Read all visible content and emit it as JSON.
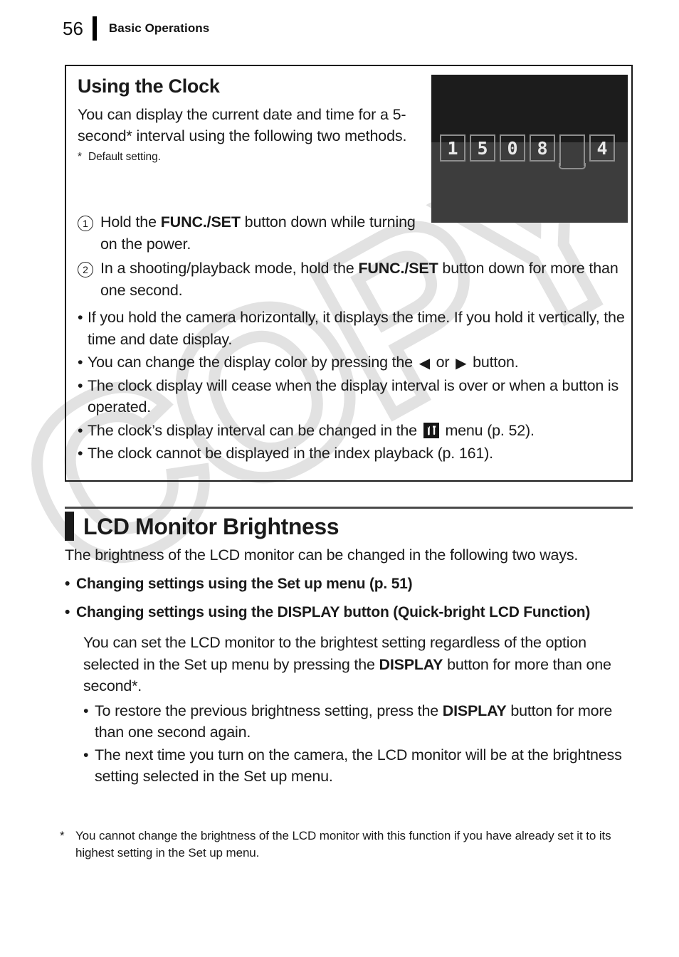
{
  "header": {
    "page_number": "56",
    "title": "Basic Operations"
  },
  "tip_box": {
    "title": "Using the Clock",
    "lead": "You can display the current date and time for a 5-second* interval using the following two methods.",
    "footnote_star": "*",
    "footnote": "Default setting.",
    "lcd_screenshot": {
      "label": "camera-lcd-clock-display",
      "digits": [
        "1",
        "5",
        "0",
        "8",
        "",
        "4"
      ],
      "blank_index": 4,
      "bg_top_color": "#1c1c1c",
      "bg_bottom_color": "#3d3d3d",
      "digit_color": "#e8e8e8",
      "cell_border_color": "#8e8e8e"
    },
    "steps": [
      {
        "num": "1",
        "pre": "Hold the ",
        "bold": "FUNC./SET",
        "post": " button down while turning on the power."
      },
      {
        "num": "2",
        "pre": "In a shooting/playback mode, hold the ",
        "bold": "FUNC./SET",
        "post": " button down for more than one second."
      }
    ],
    "bullets": [
      {
        "text": "If you hold the camera horizontally, it displays the time. If you hold it vertically, the time and date display."
      },
      {
        "pre": "You can change the display color by pressing the ",
        "icon_left": "◀",
        "mid": " or ",
        "icon_right": "▶",
        "post": " button."
      },
      {
        "text": "The clock display will cease when the display interval is over or when a button is operated."
      },
      {
        "pre": "The clock’s display interval can be changed in the ",
        "icon": "setup-tools-menu-icon",
        "post": " menu (p. 52)."
      },
      {
        "text": "The clock cannot be displayed in the index playback (p. 161)."
      }
    ]
  },
  "section": {
    "title": "LCD Monitor Brightness",
    "intro": "The brightness of the LCD monitor can be changed in the following two ways.",
    "bold_bullets": [
      "Changing settings using the Set up menu (p. 51)",
      "Changing settings using the DISPLAY button (Quick-bright LCD Function)"
    ],
    "indent_para": {
      "pre": "You can set the LCD monitor to the brightest setting regardless of the option selected in the Set up menu by pressing the ",
      "bold": "DISPLAY",
      "post": " button for more than one second*."
    },
    "sub_bullets": [
      {
        "pre": "To restore the previous brightness setting, press the ",
        "bold": "DISPLAY",
        "post": " button for more than one second again."
      },
      {
        "pre": "The next time you turn on the camera, the LCD monitor will be at the brightness setting selected in the Set up menu.",
        "bold": "",
        "post": ""
      }
    ]
  },
  "page_footnote": {
    "star": "*",
    "text": "You cannot change the brightness of the LCD monitor with this function if you have already set it to its highest setting in the Set up menu."
  },
  "watermark": {
    "text": "COPY"
  }
}
